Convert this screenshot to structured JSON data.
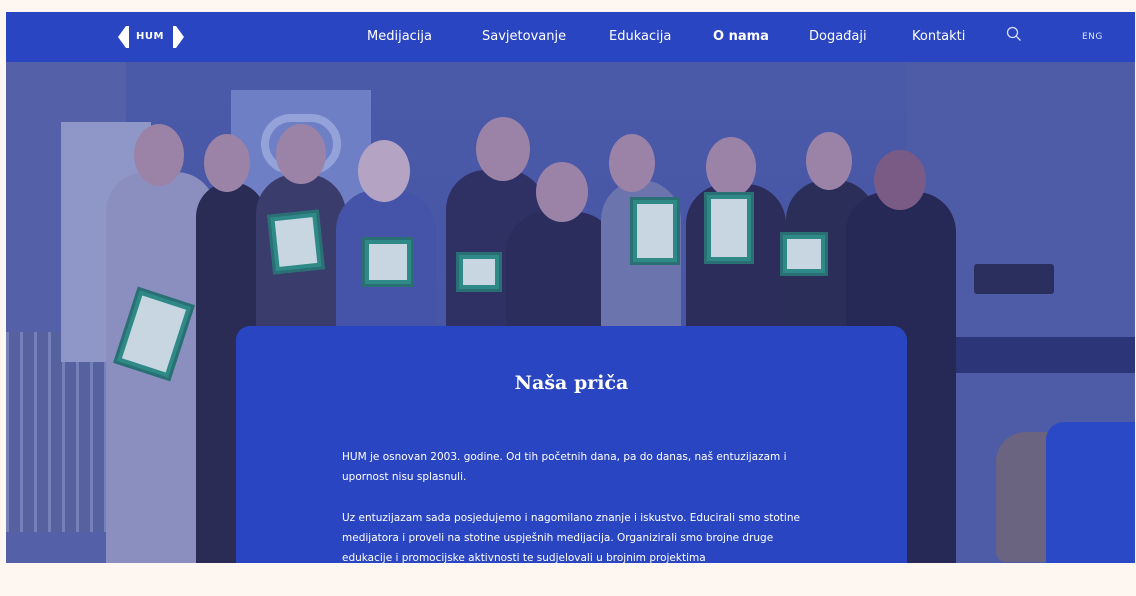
{
  "header": {
    "logo_text": "HUM",
    "nav": [
      {
        "label": "Medijacija",
        "active": false
      },
      {
        "label": "Savjetovanje",
        "active": false
      },
      {
        "label": "Edukacija",
        "active": false
      },
      {
        "label": "O nama",
        "active": true
      },
      {
        "label": "Događaji",
        "active": false
      },
      {
        "label": "Kontakti",
        "active": false
      }
    ],
    "search_icon": "search-icon",
    "language": "ENG"
  },
  "hero": {
    "image": "group-photo-certificates"
  },
  "card": {
    "title": "Naša priča",
    "paragraph1": "HUM je osnovan 2003. godine. Od tih početnih dana, pa do danas, naš entuzijazam i upornost nisu splasnuli.",
    "paragraph2": "Uz entuzijazam sada posjedujemo i nagomilano znanje i iskustvo. Educirali smo stotine medijatora i proveli na stotine uspješnih medijacija. Organizirali smo brojne druge edukacije i promocijske aktivnosti te sudjelovali u brojnim projektima"
  },
  "colors": {
    "header_bg": "#2a45c2",
    "card_bg": "#2a45c2",
    "page_bg": "#fef7f1"
  }
}
